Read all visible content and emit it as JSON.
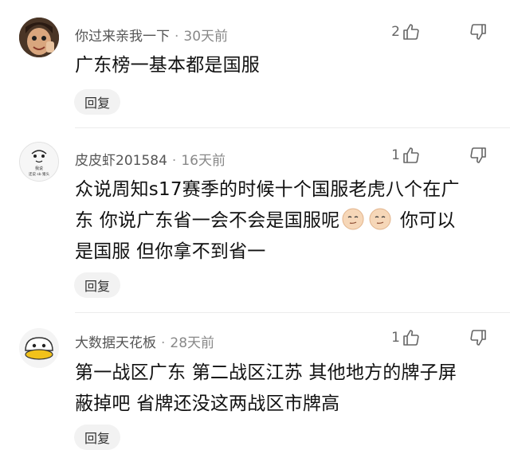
{
  "comments": [
    {
      "user": "你过来亲我一下",
      "time": "30天前",
      "likes": "2",
      "text": "广东榜一基本都是国服",
      "reply_label": "回复"
    },
    {
      "user": "皮皮虾201584",
      "time": "16天前",
      "likes": "1",
      "text_line1": "众说周知s17赛季的时候十个国服老虎八个在广",
      "text_line2_a": "东  你说广东省一会不会是国服呢",
      "text_line2_b": "  你可以",
      "text_line3": "是国服 但你拿不到省一",
      "avatar_text_top": "我说",
      "avatar_text_bottom": "还说 sb 猪头",
      "reply_label": "回复"
    },
    {
      "user": "大数据天花板",
      "time": "28天前",
      "likes": "1",
      "text_line1": "第一战区广东  第二战区江苏  其他地方的牌子屏",
      "text_line2": "蔽掉吧 省牌还没这两战区市牌高",
      "reply_label": "回复"
    }
  ],
  "separator": "·",
  "colors": {
    "reply_bg": "#f2f2f2",
    "meta": "#555555",
    "time": "#888888"
  }
}
